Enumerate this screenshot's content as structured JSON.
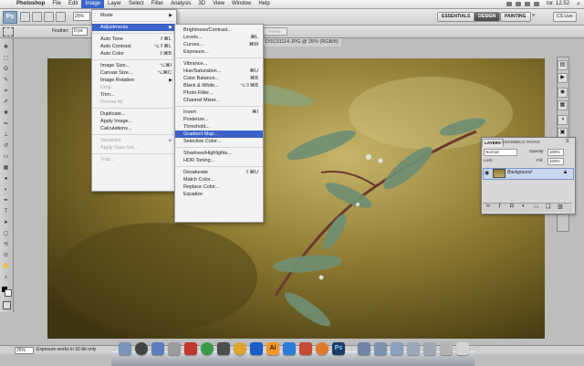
{
  "menubar": {
    "app": "Photoshop",
    "items": [
      "File",
      "Edit",
      "Image",
      "Layer",
      "Select",
      "Filter",
      "Analysis",
      "3D",
      "View",
      "Window",
      "Help"
    ],
    "open_item": "Image",
    "clock": "tor. 12.52"
  },
  "appbar": {
    "logo": "Ps",
    "zoom": "25%",
    "workspaces": [
      "ESSENTIALS",
      "DESIGN",
      "PAINTING"
    ],
    "active_workspace": "DESIGN",
    "cs_live": "CS Live"
  },
  "options": {
    "feather_label": "Feather:",
    "feather_value": "0 px",
    "refine_edge": "Refine Edge..."
  },
  "document": {
    "tab_title": "DSC01114.JPG @ 25% (RGB/8)"
  },
  "image_menu": {
    "items": [
      {
        "label": "Mode",
        "submenu": true
      },
      {
        "sep": true
      },
      {
        "label": "Adjustments",
        "submenu": true,
        "highlight": true
      },
      {
        "sep": true
      },
      {
        "label": "Auto Tone",
        "shortcut": "⇧⌘L"
      },
      {
        "label": "Auto Contrast",
        "shortcut": "⌥⇧⌘L"
      },
      {
        "label": "Auto Color",
        "shortcut": "⇧⌘B"
      },
      {
        "sep": true
      },
      {
        "label": "Image Size...",
        "shortcut": "⌥⌘I"
      },
      {
        "label": "Canvas Size...",
        "shortcut": "⌥⌘C"
      },
      {
        "label": "Image Rotation",
        "submenu": true
      },
      {
        "label": "Crop",
        "disabled": true
      },
      {
        "label": "Trim..."
      },
      {
        "label": "Reveal All",
        "disabled": true
      },
      {
        "sep": true
      },
      {
        "label": "Duplicate..."
      },
      {
        "label": "Apply Image..."
      },
      {
        "label": "Calculations..."
      },
      {
        "sep": true
      },
      {
        "label": "Variables",
        "submenu": true,
        "disabled": true
      },
      {
        "label": "Apply Data Set...",
        "disabled": true
      },
      {
        "sep": true
      },
      {
        "label": "Trap...",
        "disabled": true
      }
    ]
  },
  "adjustments_menu": {
    "items": [
      {
        "label": "Brightness/Contrast..."
      },
      {
        "label": "Levels...",
        "shortcut": "⌘L"
      },
      {
        "label": "Curves...",
        "shortcut": "⌘M"
      },
      {
        "label": "Exposure..."
      },
      {
        "sep": true
      },
      {
        "label": "Vibrance..."
      },
      {
        "label": "Hue/Saturation...",
        "shortcut": "⌘U"
      },
      {
        "label": "Color Balance...",
        "shortcut": "⌘B"
      },
      {
        "label": "Black & White...",
        "shortcut": "⌥⇧⌘B"
      },
      {
        "label": "Photo Filter..."
      },
      {
        "label": "Channel Mixer..."
      },
      {
        "sep": true
      },
      {
        "label": "Invert",
        "shortcut": "⌘I"
      },
      {
        "label": "Posterize..."
      },
      {
        "label": "Threshold..."
      },
      {
        "label": "Gradient Map...",
        "highlight": true
      },
      {
        "label": "Selective Color..."
      },
      {
        "sep": true
      },
      {
        "label": "Shadows/Highlights..."
      },
      {
        "label": "HDR Toning..."
      },
      {
        "sep": true
      },
      {
        "label": "Desaturate",
        "shortcut": "⇧⌘U"
      },
      {
        "label": "Match Color..."
      },
      {
        "label": "Replace Color..."
      },
      {
        "label": "Equalize"
      }
    ]
  },
  "layers_panel": {
    "tabs": [
      "LAYERS",
      "CHANNELS",
      "PATHS"
    ],
    "blend_mode": "Normal",
    "opacity_label": "Opacity:",
    "opacity": "100%",
    "lock_label": "Lock:",
    "fill_label": "Fill:",
    "fill": "100%",
    "layer_name": "Background"
  },
  "status": {
    "zoom": "25%",
    "text": "Exposure works in 32-bit only"
  },
  "dock": {
    "ps_label": "Ps",
    "ai_label": "Ai"
  }
}
